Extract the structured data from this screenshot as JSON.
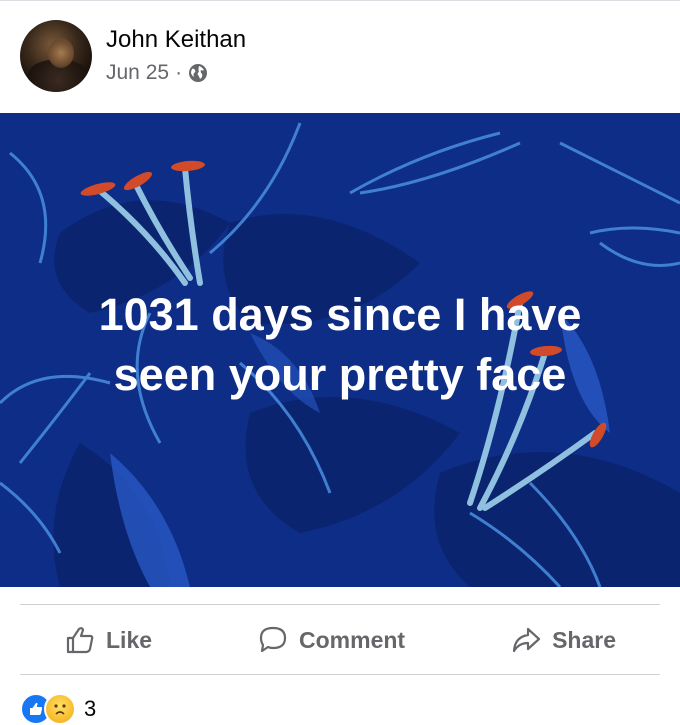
{
  "post": {
    "author": "John Keithan",
    "date": "Jun 25",
    "separator": "·",
    "privacy_icon": "globe-icon",
    "text_line1": "1031 days since I have",
    "text_line2": "seen your pretty face",
    "background_color": "#0d2d86"
  },
  "actions": {
    "like_label": "Like",
    "comment_label": "Comment",
    "share_label": "Share"
  },
  "reactions": {
    "types": [
      "like",
      "care"
    ],
    "count": "3"
  },
  "colors": {
    "secondary_text": "#65676b",
    "like_blue": "#1877f2"
  }
}
